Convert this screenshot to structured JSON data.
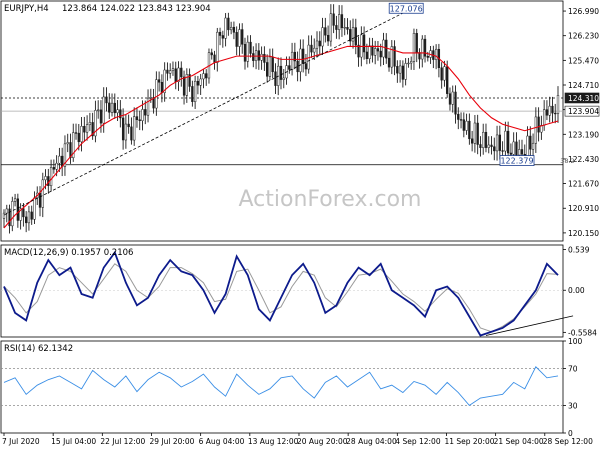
{
  "header": {
    "symbol": "EURJPY,H4",
    "ohlc": "123.864 124.022 123.843 123.904"
  },
  "watermark": "ActionForex.com",
  "colors": {
    "candle": "#1c1c1c",
    "ma": "#e8000b",
    "macd": "#0d1b8c",
    "signal": "#9a9a9a",
    "rsi": "#3b8fe6",
    "trend": "#000000",
    "label_box": "#1a3d8f",
    "badge_bg": "#1c1c1c",
    "grid": "#c8c8c8"
  },
  "chart_data": [
    {
      "type": "candlestick",
      "title": "EURJPY,H4",
      "ylim": [
        119.9,
        127.3
      ],
      "y_ticks": [
        "126.990",
        "126.230",
        "125.470",
        "124.710",
        "123.950",
        "123.190",
        "122.430",
        "121.670",
        "120.910",
        "120.150"
      ],
      "x_ticks": [
        "7 Jul 2020",
        "15 Jul 04:00",
        "22 Jul 12:00",
        "29 Jul 20:00",
        "6 Aug 04:00",
        "13 Aug 12:00",
        "20 Aug 20:00",
        "28 Aug 04:00",
        "4 Sep 12:00",
        "11 Sep 20:00",
        "21 Sep 04:00",
        "28 Sep 12:00"
      ],
      "series": [
        {
          "values": [
            120.6,
            121.0,
            120.5,
            121.2,
            121.9,
            122.4,
            122.9,
            123.3,
            123.5,
            124.1,
            124.0,
            123.2,
            123.6,
            124.1,
            124.7,
            125.2,
            124.9,
            124.5,
            125.0,
            125.8,
            126.6,
            126.2,
            125.7,
            125.6,
            125.2,
            124.9,
            125.5,
            125.4,
            125.9,
            126.3,
            126.7,
            126.4,
            125.9,
            125.7,
            125.8,
            125.5,
            125.0,
            125.9,
            125.7,
            125.6,
            124.6,
            123.7,
            123.2,
            123.0,
            122.8,
            122.9,
            122.7,
            122.6,
            123.3,
            123.9,
            124.0
          ]
        },
        {
          "name": "MA",
          "values": [
            120.3,
            120.7,
            121.0,
            121.3,
            121.7,
            122.1,
            122.5,
            122.9,
            123.2,
            123.5,
            123.7,
            123.8,
            124.0,
            124.2,
            124.4,
            124.7,
            124.9,
            125.0,
            125.2,
            125.4,
            125.5,
            125.6,
            125.6,
            125.6,
            125.6,
            125.5,
            125.5,
            125.5,
            125.6,
            125.7,
            125.8,
            125.9,
            125.9,
            125.9,
            125.9,
            125.8,
            125.7,
            125.7,
            125.7,
            125.6,
            125.3,
            124.9,
            124.4,
            124.0,
            123.7,
            123.5,
            123.4,
            123.3,
            123.4,
            123.5,
            123.6
          ]
        }
      ],
      "trendline": {
        "x": [
          0,
          37
        ],
        "y": [
          120.7,
          127.1
        ]
      },
      "hlines": [
        124.31,
        123.904,
        122.25
      ],
      "annotations": [
        {
          "label": "127.076",
          "x": 36.3,
          "y": 127.076
        },
        {
          "label": "122.379",
          "x": 46.3,
          "y": 122.38
        },
        {
          "label": "38.2",
          "x": 50.2,
          "y": 122.25
        }
      ],
      "badges": [
        {
          "label": "124.310",
          "y": 124.31
        },
        {
          "label": "123.904",
          "y": 123.904
        }
      ]
    },
    {
      "type": "line",
      "title": "MACD(12,26,9) 0.1957 0.2106",
      "ylim": [
        -0.62,
        0.6
      ],
      "y_ticks": [
        "0.539",
        "0.00",
        "-0.5584"
      ],
      "series": [
        {
          "values": [
            0.05,
            -0.3,
            -0.4,
            0.1,
            0.4,
            0.2,
            0.3,
            -0.05,
            -0.1,
            0.3,
            0.5,
            0.1,
            -0.2,
            -0.1,
            0.2,
            0.4,
            0.25,
            0.2,
            0.0,
            -0.3,
            -0.05,
            0.45,
            0.2,
            -0.25,
            -0.4,
            -0.1,
            0.2,
            0.35,
            0.1,
            -0.3,
            -0.2,
            0.1,
            0.3,
            0.2,
            0.35,
            0.0,
            -0.1,
            -0.2,
            -0.35,
            0.0,
            0.05,
            -0.1,
            -0.35,
            -0.6,
            -0.55,
            -0.5,
            -0.4,
            -0.2,
            0.0,
            0.35,
            0.2
          ]
        },
        {
          "values": [
            0.05,
            -0.1,
            -0.3,
            -0.15,
            0.2,
            0.3,
            0.25,
            0.1,
            -0.05,
            0.15,
            0.35,
            0.25,
            0.0,
            -0.1,
            0.05,
            0.3,
            0.3,
            0.22,
            0.1,
            -0.15,
            -0.12,
            0.25,
            0.28,
            0.0,
            -0.3,
            -0.22,
            0.05,
            0.25,
            0.2,
            -0.1,
            -0.22,
            -0.02,
            0.2,
            0.22,
            0.28,
            0.12,
            -0.05,
            -0.15,
            -0.28,
            -0.12,
            0.02,
            -0.04,
            -0.25,
            -0.5,
            -0.55,
            -0.48,
            -0.38,
            -0.22,
            -0.05,
            0.22,
            0.21
          ]
        }
      ],
      "trendline": {
        "x": [
          43.5,
          51
        ],
        "y": [
          -0.6,
          -0.34
        ]
      }
    },
    {
      "type": "line",
      "title": "RSI(14) 62.1342",
      "ylim": [
        0,
        100
      ],
      "y_ticks": [
        "100",
        "70",
        "30",
        "0"
      ],
      "hlines": [
        70,
        30
      ],
      "series": [
        {
          "values": [
            55,
            60,
            42,
            52,
            58,
            62,
            55,
            48,
            68,
            58,
            50,
            62,
            45,
            58,
            66,
            60,
            50,
            56,
            64,
            50,
            40,
            64,
            52,
            42,
            48,
            60,
            62,
            48,
            38,
            55,
            62,
            50,
            58,
            66,
            48,
            52,
            44,
            56,
            52,
            42,
            55,
            44,
            30,
            38,
            40,
            42,
            55,
            48,
            72,
            60,
            62
          ]
        }
      ]
    }
  ]
}
